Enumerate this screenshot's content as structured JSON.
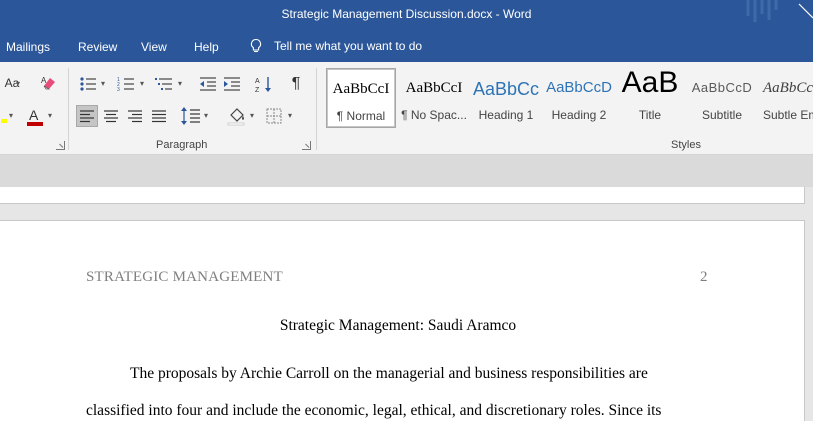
{
  "window": {
    "title": "Strategic Management Discussion.docx  -  Word"
  },
  "tabs": {
    "mailings": "Mailings",
    "review": "Review",
    "view": "View",
    "help": "Help",
    "tell_me": "Tell me what you want to do"
  },
  "ribbon": {
    "font_size_label": "Aa",
    "paragraph_label": "Paragraph",
    "styles_label": "Styles",
    "pilcrow": "¶",
    "font_color": "#c00000",
    "highlight_color": "#ffff00"
  },
  "styles": [
    {
      "preview": "AaBbCcI",
      "name": "¶ Normal"
    },
    {
      "preview": "AaBbCcI",
      "name": "¶ No Spac..."
    },
    {
      "preview": "AaBbCc",
      "name": "Heading 1"
    },
    {
      "preview": "AaBbCcD",
      "name": "Heading 2"
    },
    {
      "preview": "AaB",
      "name": "Title"
    },
    {
      "preview": "AaBbCcD",
      "name": "Subtitle"
    },
    {
      "preview": "AaBbCc",
      "name": "Subtle Em"
    }
  ],
  "document": {
    "running_head": "STRATEGIC MANAGEMENT",
    "page_number": "2",
    "title": "Strategic Management: Saudi Aramco",
    "line1": "The proposals by Archie Carroll on the managerial and business responsibilities are",
    "line2": "classified into four and include the economic, legal, ethical, and discretionary roles. Since its"
  }
}
